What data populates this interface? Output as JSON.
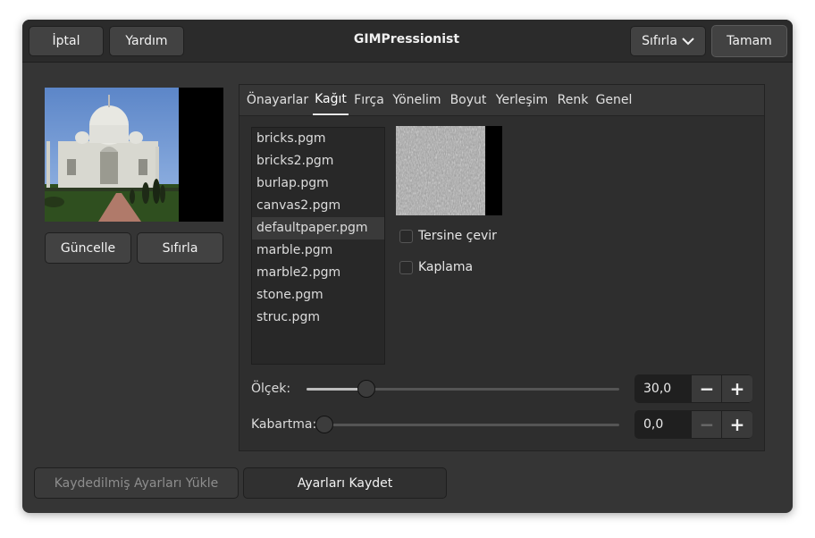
{
  "header": {
    "cancel": "İptal",
    "help": "Yardım",
    "title": "GIMPressionist",
    "reset": "Sıfırla",
    "ok": "Tamam"
  },
  "preview": {
    "update": "Güncelle",
    "reset": "Sıfırla"
  },
  "tabs": [
    "Önayarlar",
    "Kağıt",
    "Fırça",
    "Yönelim",
    "Boyut",
    "Yerleşim",
    "Renk",
    "Genel"
  ],
  "active_tab": "Kağıt",
  "papers": {
    "items": [
      "bricks.pgm",
      "bricks2.pgm",
      "burlap.pgm",
      "canvas2.pgm",
      "defaultpaper.pgm",
      "marble.pgm",
      "marble2.pgm",
      "stone.pgm",
      "struc.pgm"
    ],
    "selected": "defaultpaper.pgm"
  },
  "options": {
    "invert": "Tersine çevir",
    "overlay": "Kaplama"
  },
  "scale": {
    "label": "Ölçek:",
    "value": "30,0",
    "fraction": 0.19
  },
  "relief": {
    "label": "Kabartma:",
    "value": "0,0",
    "fraction": 0.0
  },
  "footer": {
    "load": "Kaydedilmiş Ayarları Yükle",
    "save": "Ayarları Kaydet"
  }
}
